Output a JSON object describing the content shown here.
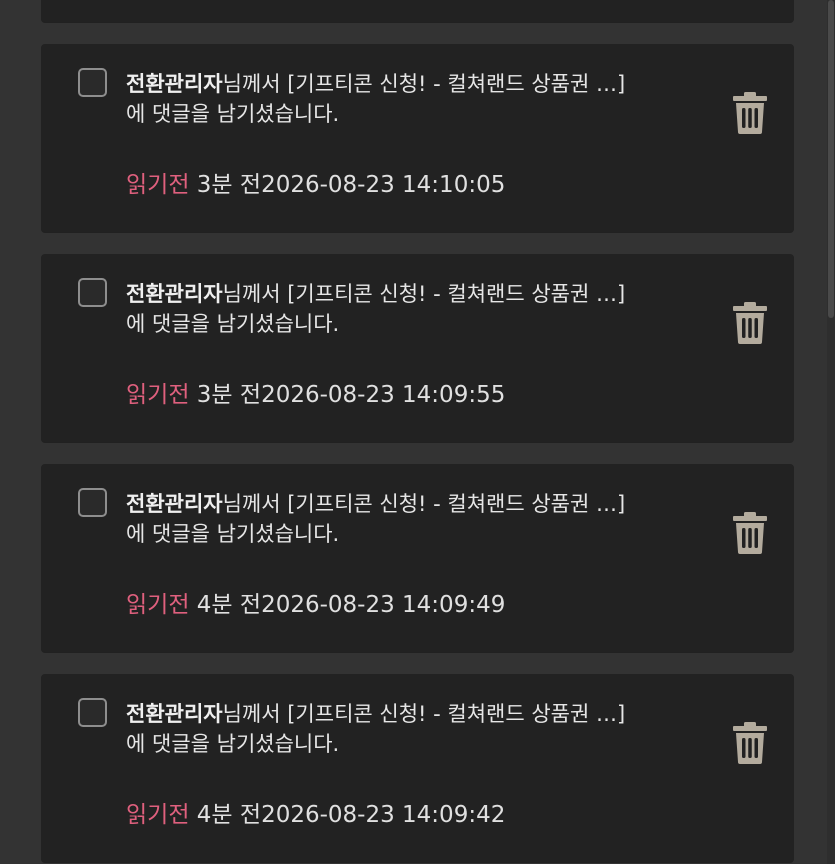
{
  "notifications": [
    {
      "sender": "전환관리자",
      "message_line1": "님께서 [기프티콘 신청! - 컬쳐랜드 상품권 …]",
      "message_line2": "에 댓글을 남기셨습니다.",
      "status": "읽기전",
      "relative_time": " 3분 전",
      "timestamp": "2026-08-23 14:10:05"
    },
    {
      "sender": "전환관리자",
      "message_line1": "님께서 [기프티콘 신청! - 컬쳐랜드 상품권 …]",
      "message_line2": "에 댓글을 남기셨습니다.",
      "status": "읽기전",
      "relative_time": " 3분 전",
      "timestamp": "2026-08-23 14:09:55"
    },
    {
      "sender": "전환관리자",
      "message_line1": "님께서 [기프티콘 신청! - 컬쳐랜드 상품권 …]",
      "message_line2": "에 댓글을 남기셨습니다.",
      "status": "읽기전",
      "relative_time": " 4분 전",
      "timestamp": "2026-08-23 14:09:49"
    },
    {
      "sender": "전환관리자",
      "message_line1": "님께서 [기프티콘 신청! - 컬쳐랜드 상품권 …]",
      "message_line2": "에 댓글을 남기셨습니다.",
      "status": "읽기전",
      "relative_time": " 4분 전",
      "timestamp": "2026-08-23 14:09:42"
    }
  ],
  "colors": {
    "background": "#333333",
    "card": "#222222",
    "unread_status": "#e0607e",
    "trash_icon": "#b3ab9d",
    "checkbox_border": "#8e8e8e"
  },
  "icons": {
    "checkbox": "checkbox-icon",
    "delete": "trash-icon"
  }
}
